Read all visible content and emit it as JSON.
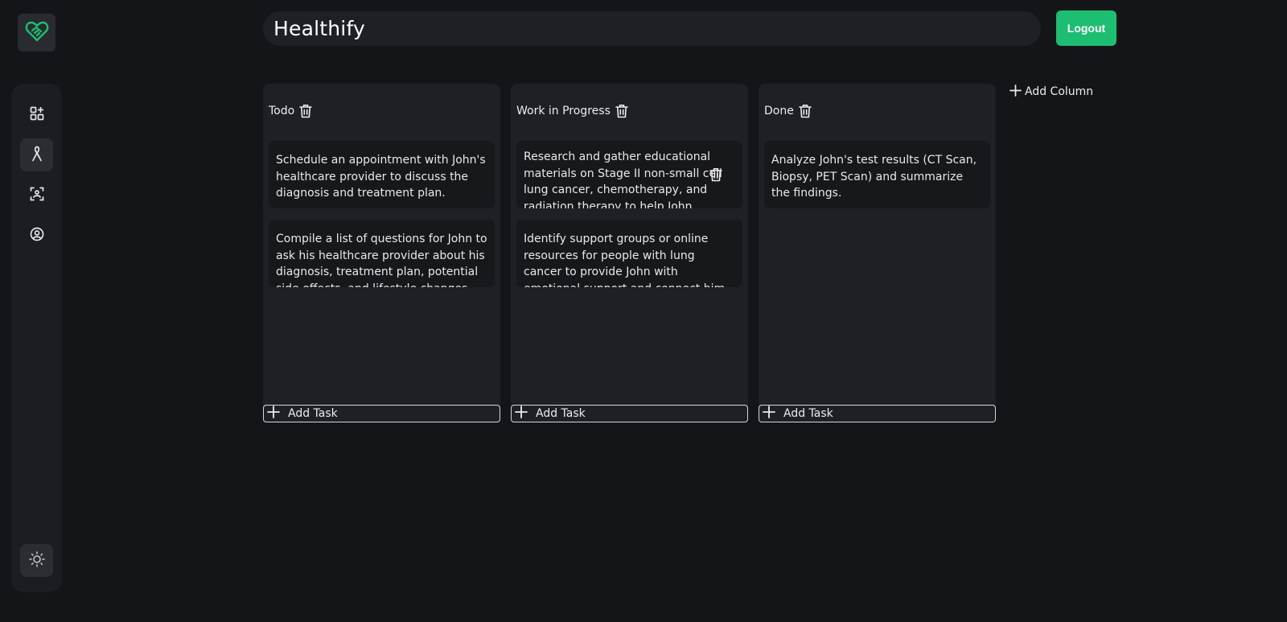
{
  "app": {
    "title": "Healthify",
    "brand_color": "#1dbd72"
  },
  "header": {
    "logout_label": "Logout"
  },
  "sidebar": {
    "items": [
      {
        "icon": "add-widget-icon",
        "active": false
      },
      {
        "icon": "ribbon-icon",
        "active": true
      },
      {
        "icon": "scan-icon",
        "active": false
      },
      {
        "icon": "user-circle-icon",
        "active": false
      }
    ],
    "theme_icon": "sun-icon"
  },
  "board": {
    "add_column_label": "Add Column",
    "columns": [
      {
        "title": "Todo",
        "add_task_label": "Add Task",
        "cards": [
          "Schedule an appointment with John's healthcare provider to discuss the diagnosis and treatment plan.",
          "Compile a list of questions for John to ask his healthcare provider about his diagnosis, treatment plan, potential side effects, and lifestyle changes."
        ]
      },
      {
        "title": "Work in Progress",
        "add_task_label": "Add Task",
        "cards": [
          "Research and gather educational materials on Stage II non-small cell lung cancer, chemotherapy, and radiation therapy to help John",
          "Identify support groups or online resources for people with lung cancer to provide John with emotional support and connect him with others"
        ]
      },
      {
        "title": "Done",
        "add_task_label": "Add Task",
        "cards": [
          "Analyze John's test results (CT Scan, Biopsy, PET Scan) and summarize the findings."
        ]
      }
    ]
  }
}
